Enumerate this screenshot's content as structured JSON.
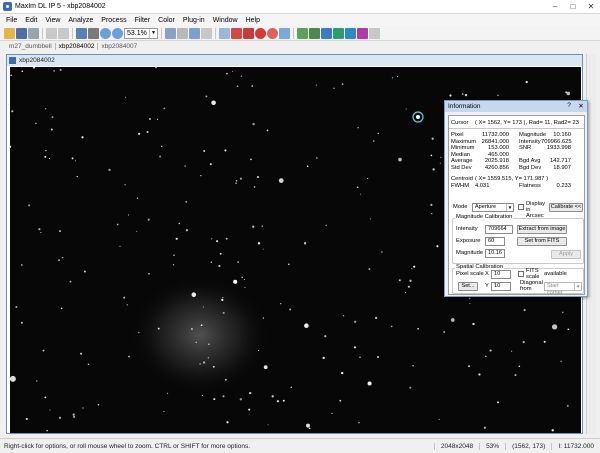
{
  "window": {
    "title": "MaxIm DL IP 5 - xbp2084002"
  },
  "menu": [
    "File",
    "Edit",
    "View",
    "Analyze",
    "Process",
    "Filter",
    "Color",
    "Plug-in",
    "Window",
    "Help"
  ],
  "toolbar": {
    "zoom_value": "53.1%"
  },
  "tabs": [
    "m27_dumbbell",
    "xbp2084002",
    "xbp2084007"
  ],
  "document": {
    "title": "xbp2084002"
  },
  "info": {
    "title": "Information",
    "cursor_label": "Cursor",
    "cursor_value": "( X= 1562, Y= 173 ), Rad= 11, Rad2= 23",
    "stats_left": [
      {
        "label": "Pixel",
        "value": "11732.000"
      },
      {
        "label": "Maximum",
        "value": "26841.000"
      },
      {
        "label": "Minimum",
        "value": "153.000"
      },
      {
        "label": "Median",
        "value": "465.000"
      },
      {
        "label": "Average",
        "value": "2025.918"
      },
      {
        "label": "Std Dev",
        "value": "4260.856"
      }
    ],
    "stats_right": [
      {
        "label": "Magnitude",
        "value": "10.160"
      },
      {
        "label": "Intensity",
        "value": "709966.625"
      },
      {
        "label": "SNR",
        "value": "1933.998"
      },
      {
        "label": "",
        "value": ""
      },
      {
        "label": "Bgd Avg",
        "value": "142.717"
      },
      {
        "label": "Bgd Dev",
        "value": "18.907"
      }
    ],
    "centroid_label": "Centroid",
    "centroid_value": "( X= 1559.515, Y= 171.987 )",
    "fwhm_label": "FWHM",
    "fwhm_value": "4.031",
    "flatness_label": "Flatness",
    "flatness_value": "0.233",
    "mode_label": "Mode",
    "mode_value": "Aperture",
    "display_arcsec_label": "Display in Arcsec",
    "calibrate_label": "Calibrate <<",
    "mag_group_title": "Magnitude Calibration",
    "intensity_label": "Intensity",
    "intensity_value": "709664",
    "extract_label": "Extract from image",
    "exposure_label": "Exposure",
    "exposure_value": "60",
    "setfits_label": "Set from FITS",
    "magnitude_label": "Magnitude",
    "magnitude_value": "10.16",
    "apply_label": "Apply",
    "spatial_group_title": "Spatial Calibration",
    "pixel_scale_label": "Pixel scale",
    "x_label": "X",
    "x_value": "10",
    "y_label": "Y",
    "y_value": "10",
    "set_label": "Set...",
    "fits_scale_label": "FITS scale",
    "fits_available": "available",
    "diagonal_label": "Diagonal from",
    "diagonal_value": "Start corner"
  },
  "status": {
    "message": "Right-click for options, or roll mouse wheel to zoom. CTRL or SHIFT for more options.",
    "size": "2048x2048",
    "zoom": "53%",
    "coords": "(1562, 173)",
    "intensity": "I: 11732.000"
  }
}
